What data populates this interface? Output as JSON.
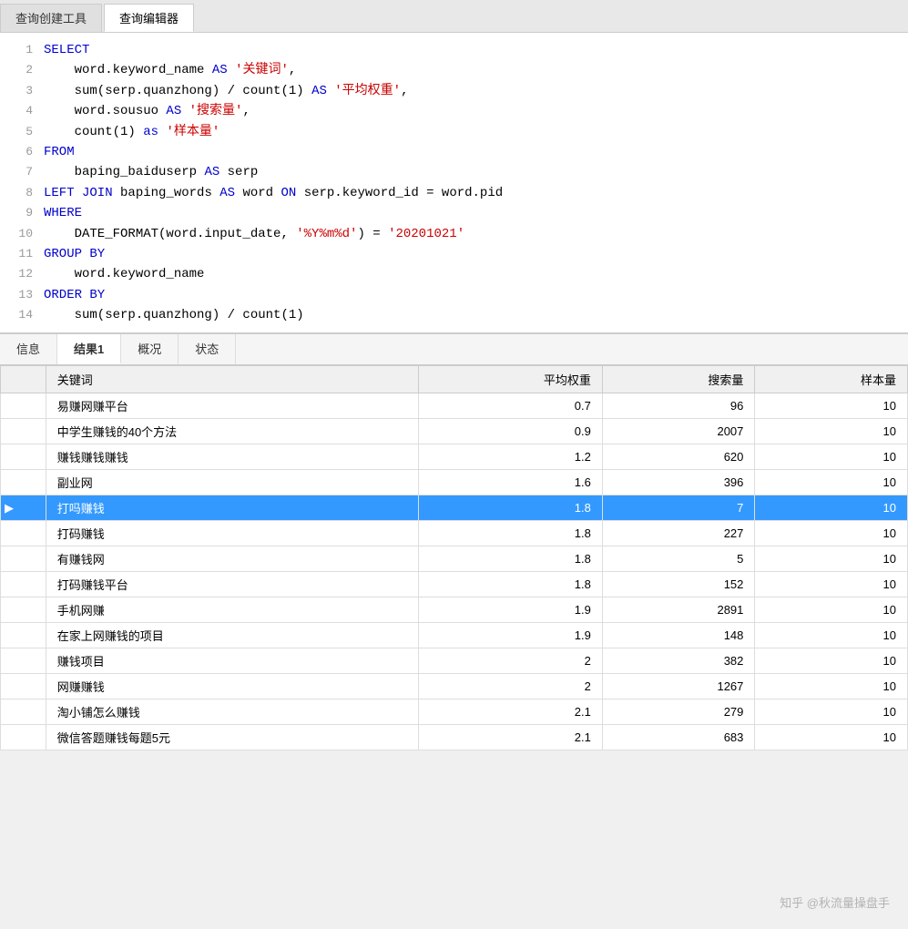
{
  "tabs": {
    "items": [
      {
        "label": "查询创建工具",
        "active": false
      },
      {
        "label": "查询编辑器",
        "active": true
      }
    ]
  },
  "code": {
    "lines": [
      {
        "num": 1,
        "parts": [
          {
            "text": "SELECT",
            "cls": "kw"
          }
        ]
      },
      {
        "num": 2,
        "parts": [
          {
            "text": "    word.keyword_name ",
            "cls": "col"
          },
          {
            "text": "AS",
            "cls": "as-kw"
          },
          {
            "text": " ",
            "cls": ""
          },
          {
            "text": "'关键词'",
            "cls": "str"
          },
          {
            "text": ",",
            "cls": "col"
          }
        ]
      },
      {
        "num": 3,
        "parts": [
          {
            "text": "    sum(serp.quanzhong) / count(1) ",
            "cls": "col"
          },
          {
            "text": "AS",
            "cls": "as-kw"
          },
          {
            "text": " ",
            "cls": ""
          },
          {
            "text": "'平均权重'",
            "cls": "str"
          },
          {
            "text": ",",
            "cls": "col"
          }
        ]
      },
      {
        "num": 4,
        "parts": [
          {
            "text": "    word.sousuo ",
            "cls": "col"
          },
          {
            "text": "AS",
            "cls": "as-kw"
          },
          {
            "text": " ",
            "cls": ""
          },
          {
            "text": "'搜索量'",
            "cls": "str"
          },
          {
            "text": ",",
            "cls": "col"
          }
        ]
      },
      {
        "num": 5,
        "parts": [
          {
            "text": "    count(1) ",
            "cls": "col"
          },
          {
            "text": "as",
            "cls": "as-kw"
          },
          {
            "text": " ",
            "cls": ""
          },
          {
            "text": "'样本量'",
            "cls": "str"
          }
        ]
      },
      {
        "num": 6,
        "parts": [
          {
            "text": "FROM",
            "cls": "kw"
          }
        ]
      },
      {
        "num": 7,
        "parts": [
          {
            "text": "    baping_baiduserp ",
            "cls": "col"
          },
          {
            "text": "AS",
            "cls": "as-kw"
          },
          {
            "text": " serp",
            "cls": "col"
          }
        ]
      },
      {
        "num": 8,
        "parts": [
          {
            "text": "LEFT JOIN",
            "cls": "kw"
          },
          {
            "text": " baping_words ",
            "cls": "col"
          },
          {
            "text": "AS",
            "cls": "as-kw"
          },
          {
            "text": " word ",
            "cls": "col"
          },
          {
            "text": "ON",
            "cls": "kw"
          },
          {
            "text": " serp.keyword_id = word.pid",
            "cls": "col"
          }
        ]
      },
      {
        "num": 9,
        "parts": [
          {
            "text": "WHERE",
            "cls": "kw"
          }
        ]
      },
      {
        "num": 10,
        "parts": [
          {
            "text": "    DATE_FORMAT(word.input_date, ",
            "cls": "col"
          },
          {
            "text": "'%Y%m%d'",
            "cls": "str"
          },
          {
            "text": ") = ",
            "cls": "col"
          },
          {
            "text": "'20201021'",
            "cls": "str"
          }
        ]
      },
      {
        "num": 11,
        "parts": [
          {
            "text": "GROUP BY",
            "cls": "kw"
          }
        ]
      },
      {
        "num": 12,
        "parts": [
          {
            "text": "    word.keyword_name",
            "cls": "col"
          }
        ]
      },
      {
        "num": 13,
        "parts": [
          {
            "text": "ORDER BY",
            "cls": "kw"
          }
        ]
      },
      {
        "num": 14,
        "parts": [
          {
            "text": "    sum(serp.quanzhong) / count(1)",
            "cls": "col"
          }
        ]
      }
    ]
  },
  "result_tabs": [
    {
      "label": "信息",
      "active": false
    },
    {
      "label": "结果1",
      "active": true
    },
    {
      "label": "概况",
      "active": false
    },
    {
      "label": "状态",
      "active": false
    }
  ],
  "table": {
    "headers": [
      {
        "label": "关键词",
        "cls": ""
      },
      {
        "label": "平均权重",
        "cls": "num-col"
      },
      {
        "label": "搜索量",
        "cls": "num-col"
      },
      {
        "label": "样本量",
        "cls": "num-col"
      }
    ],
    "rows": [
      {
        "keyword": "易赚网赚平台",
        "weight": "0.7",
        "search": "96",
        "sample": "10",
        "selected": false
      },
      {
        "keyword": "中学生赚钱的40个方法",
        "weight": "0.9",
        "search": "2007",
        "sample": "10",
        "selected": false
      },
      {
        "keyword": "赚钱赚钱赚钱",
        "weight": "1.2",
        "search": "620",
        "sample": "10",
        "selected": false
      },
      {
        "keyword": "副业网",
        "weight": "1.6",
        "search": "396",
        "sample": "10",
        "selected": false
      },
      {
        "keyword": "打吗赚钱",
        "weight": "1.8",
        "search": "7",
        "sample": "10",
        "selected": true
      },
      {
        "keyword": "打码赚钱",
        "weight": "1.8",
        "search": "227",
        "sample": "10",
        "selected": false
      },
      {
        "keyword": "有赚钱网",
        "weight": "1.8",
        "search": "5",
        "sample": "10",
        "selected": false
      },
      {
        "keyword": "打码赚钱平台",
        "weight": "1.8",
        "search": "152",
        "sample": "10",
        "selected": false
      },
      {
        "keyword": "手机网赚",
        "weight": "1.9",
        "search": "2891",
        "sample": "10",
        "selected": false
      },
      {
        "keyword": "在家上网赚钱的项目",
        "weight": "1.9",
        "search": "148",
        "sample": "10",
        "selected": false
      },
      {
        "keyword": "赚钱项目",
        "weight": "2",
        "search": "382",
        "sample": "10",
        "selected": false
      },
      {
        "keyword": "网赚赚钱",
        "weight": "2",
        "search": "1267",
        "sample": "10",
        "selected": false
      },
      {
        "keyword": "淘小铺怎么赚钱",
        "weight": "2.1",
        "search": "279",
        "sample": "10",
        "selected": false
      },
      {
        "keyword": "微信答题赚钱每题5元",
        "weight": "2.1",
        "search": "683",
        "sample": "10",
        "selected": false
      }
    ]
  },
  "watermark": "知乎 @秋流量操盘手"
}
